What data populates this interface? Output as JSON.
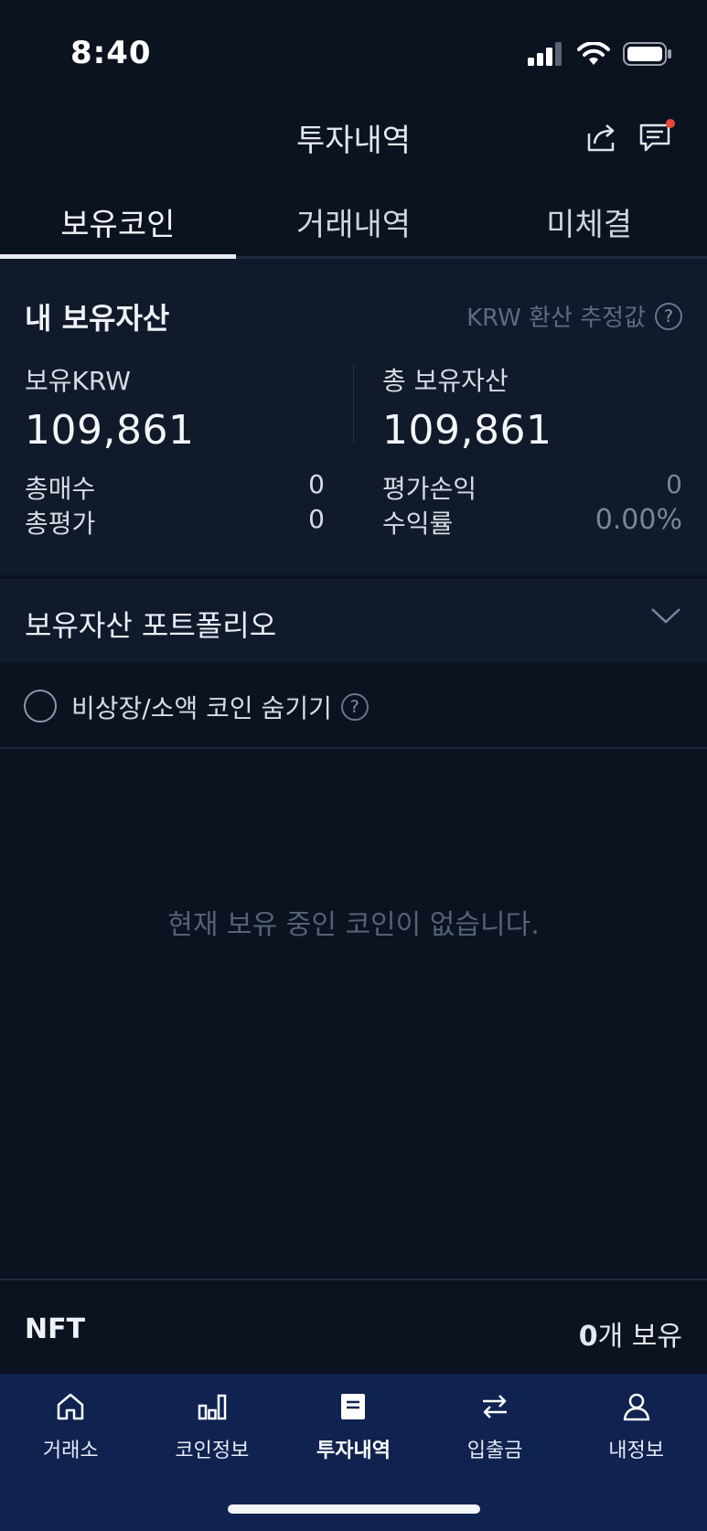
{
  "status_bar": {
    "time": "8:40"
  },
  "header": {
    "title": "투자내역",
    "notification_dot_color": "#e8453c"
  },
  "tabs": [
    {
      "label": "보유코인",
      "active": true
    },
    {
      "label": "거래내역",
      "active": false
    },
    {
      "label": "미체결",
      "active": false
    }
  ],
  "assets": {
    "title": "내 보유자산",
    "hint": "KRW 환산 추정값",
    "krw_label": "보유KRW",
    "krw_value": "109,861",
    "total_label": "총 보유자산",
    "total_value": "109,861",
    "buy_total_label": "총매수",
    "buy_total_value": "0",
    "eval_total_label": "총평가",
    "eval_total_value": "0",
    "pnl_label": "평가손익",
    "pnl_value": "0",
    "return_label": "수익률",
    "return_value": "0.00%"
  },
  "portfolio": {
    "title": "보유자산 포트폴리오"
  },
  "filter": {
    "label": "비상장/소액 코인 숨기기",
    "checked": false
  },
  "empty_message": "현재 보유 중인 코인이 없습니다.",
  "nft": {
    "label": "NFT",
    "count": "0",
    "count_suffix": "개 보유"
  },
  "nav": [
    {
      "label": "거래소",
      "icon": "home-icon",
      "active": false
    },
    {
      "label": "코인정보",
      "icon": "bar-chart-icon",
      "active": false
    },
    {
      "label": "투자내역",
      "icon": "document-icon",
      "active": true
    },
    {
      "label": "입출금",
      "icon": "transfer-icon",
      "active": false
    },
    {
      "label": "내정보",
      "icon": "user-icon",
      "active": false
    }
  ]
}
